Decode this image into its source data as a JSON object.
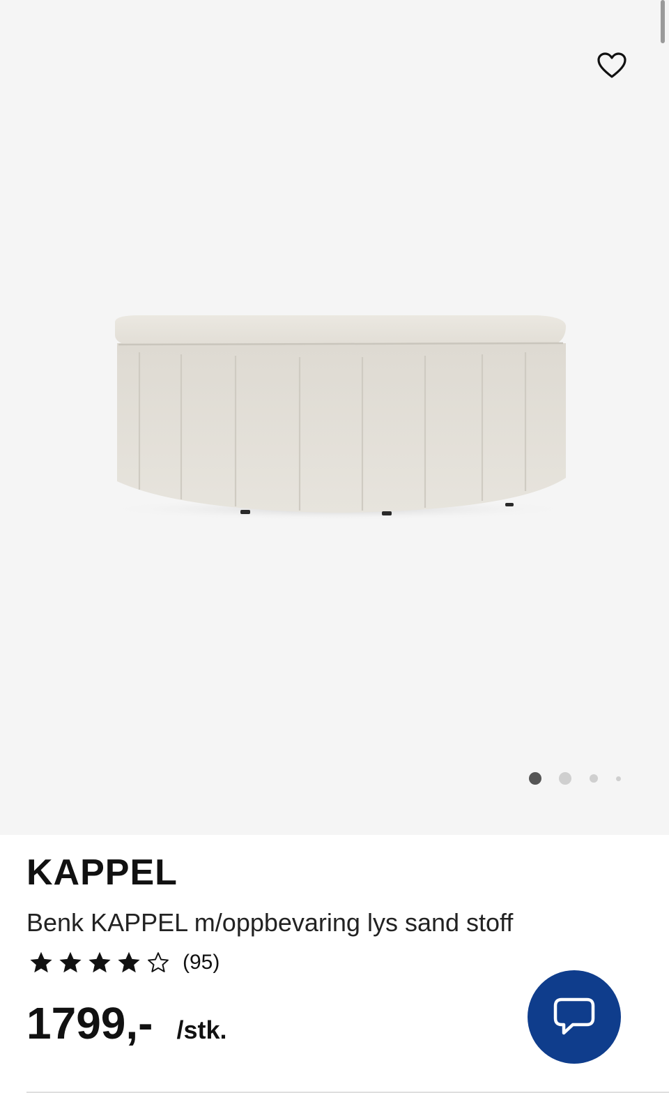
{
  "product": {
    "name": "KAPPEL",
    "description": "Benk KAPPEL m/oppbevaring lys sand stoff",
    "rating": {
      "value": 4,
      "max": 5,
      "count_label": "(95)"
    },
    "price": "1799,-",
    "unit": "/stk."
  },
  "gallery": {
    "image_count": 4,
    "active_index": 0
  },
  "icons": {
    "favorite": "heart-outline-icon",
    "chat": "chat-bubble-icon",
    "star_filled": "star-filled-icon",
    "star_empty": "star-outline-icon"
  },
  "colors": {
    "gallery_bg": "#f5f5f5",
    "chat_button": "#0f3d8c",
    "text": "#111111",
    "dot_active": "#555555",
    "dot_inactive": "#cfcfcf"
  }
}
